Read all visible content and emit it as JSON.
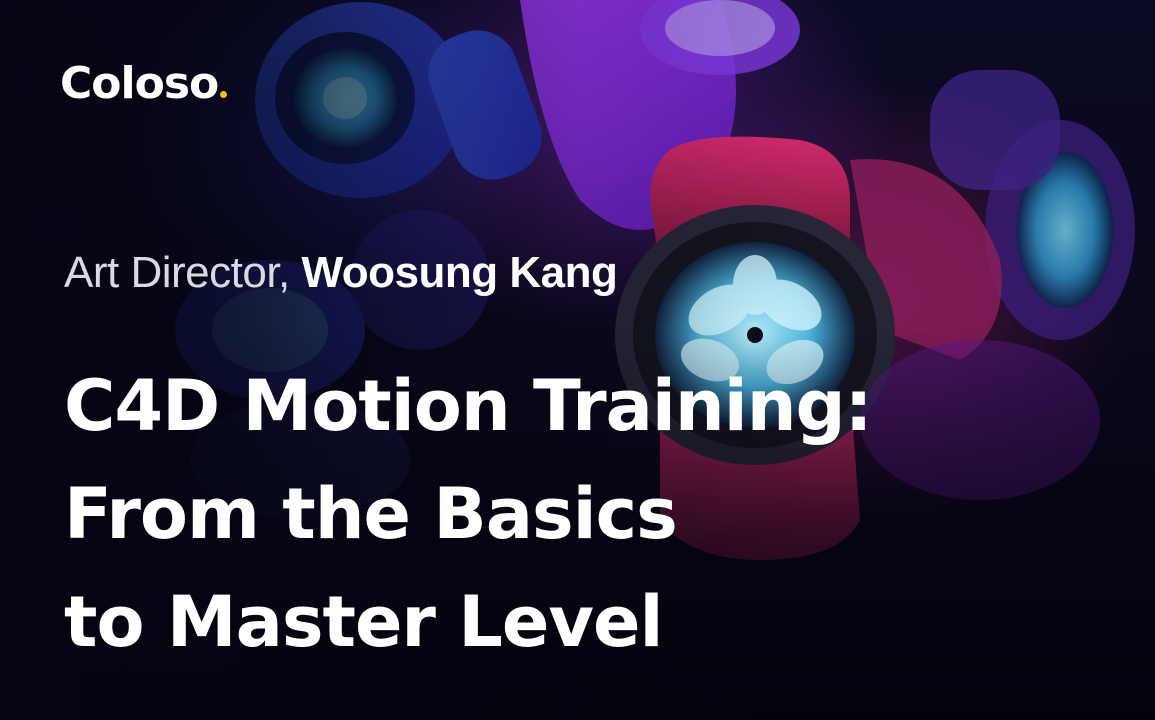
{
  "brand": {
    "name": "Coloso",
    "accent_color": "#f2c10e"
  },
  "instructor": {
    "role": "Art Director,",
    "name": "Woosung Kang"
  },
  "course": {
    "title_lines": [
      "C4D Motion Training:",
      "From the Basics",
      "to Master Level"
    ]
  },
  "background": {
    "palette": [
      "#1a2cff",
      "#7a2cff",
      "#c21a6e",
      "#8a1c3a",
      "#35c6e8"
    ],
    "icon": "smartwatch-illustration"
  }
}
